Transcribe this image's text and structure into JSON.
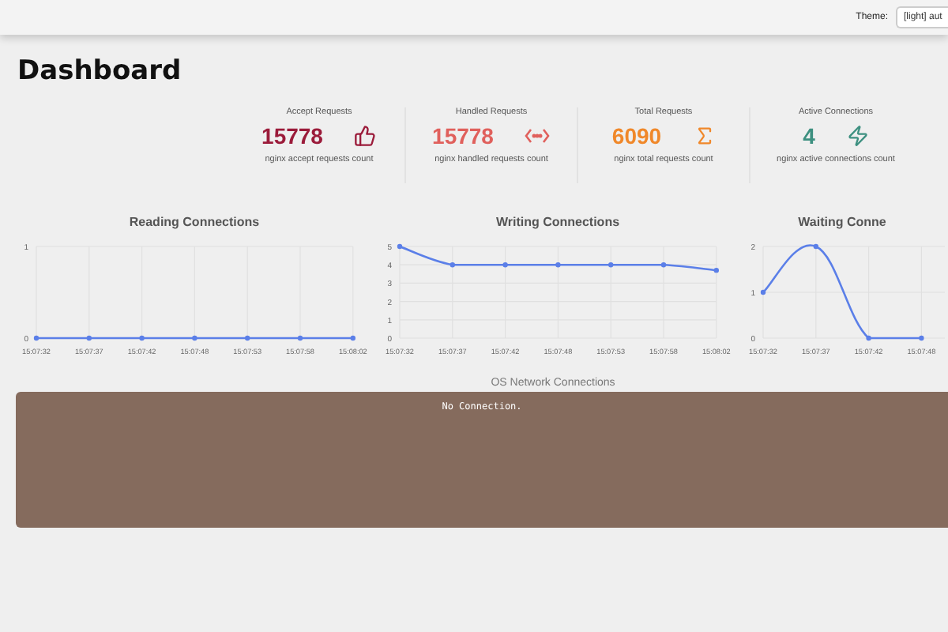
{
  "header": {
    "theme_label": "Theme:",
    "theme_value": "[light] aut"
  },
  "title": "Dashboard",
  "stats": [
    {
      "label": "Accept Requests",
      "value": "15778",
      "description": "nginx accept requests count",
      "color": "#9b1b3a",
      "kind": "thumbs"
    },
    {
      "label": "Handled Requests",
      "value": "15778",
      "description": "nginx handled requests count",
      "color": "#e0605c",
      "kind": "code"
    },
    {
      "label": "Total Requests",
      "value": "6090",
      "description": "nginx total requests count",
      "color": "#f0882a",
      "kind": "sigma"
    },
    {
      "label": "Active Connections",
      "value": "4",
      "description": "nginx active connections count",
      "color": "#3d9080",
      "kind": "zap"
    }
  ],
  "charts": [
    {
      "chart_data": {
        "type": "line",
        "title": "Reading Connections",
        "categories": [
          "15:07:32",
          "15:07:37",
          "15:07:42",
          "15:07:48",
          "15:07:53",
          "15:07:58",
          "15:08:02"
        ],
        "series": [
          {
            "color": "#5b7fe8",
            "marker": true,
            "values": [
              0,
              0,
              0,
              0,
              0,
              0,
              0
            ]
          }
        ],
        "yticks": [
          0,
          1
        ],
        "ylim": [
          0,
          1
        ],
        "grid": true
      }
    },
    {
      "chart_data": {
        "type": "line",
        "title": "Writing Connections",
        "categories": [
          "15:07:32",
          "15:07:37",
          "15:07:42",
          "15:07:48",
          "15:07:53",
          "15:07:58",
          "15:08:02"
        ],
        "series": [
          {
            "color": "#5b7fe8",
            "marker": true,
            "values": [
              5,
              4,
              4,
              4,
              4,
              4,
              3.7
            ]
          }
        ],
        "yticks": [
          0,
          1,
          2,
          3,
          4,
          5
        ],
        "ylim": [
          0,
          5
        ],
        "grid": true
      }
    },
    {
      "chart_data": {
        "type": "line",
        "title": "Waiting Conne",
        "categories": [
          "15:07:32",
          "15:07:37",
          "15:07:42",
          "15:07:48"
        ],
        "series": [
          {
            "color": "#5b7fe8",
            "marker": true,
            "values": [
              1,
              2,
              0,
              0
            ]
          }
        ],
        "yticks": [
          0,
          1,
          2
        ],
        "ylim": [
          0,
          2
        ],
        "grid": true
      }
    }
  ],
  "network": {
    "title": "OS Network Connections",
    "message": "No Connection."
  }
}
